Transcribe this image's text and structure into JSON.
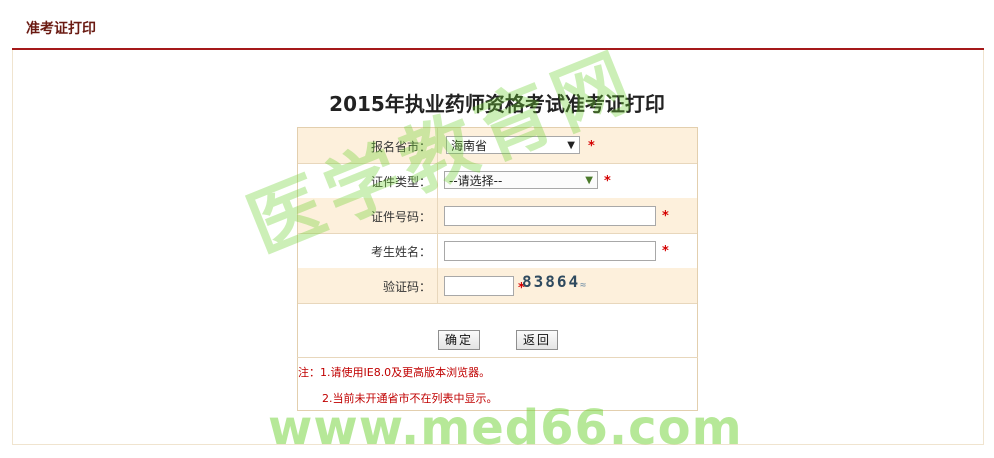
{
  "header": {
    "title": "准考证打印"
  },
  "page_title": "2015年执业药师资格考试准考证打印",
  "form": {
    "province": {
      "label": "报名省市：",
      "value": "海南省"
    },
    "id_type": {
      "label": "证件类型：",
      "value": "--请选择--"
    },
    "id_number": {
      "label": "证件号码：",
      "value": ""
    },
    "name": {
      "label": "考生姓名：",
      "value": ""
    },
    "captcha": {
      "label": "验证码：",
      "value": "",
      "image_text": "83864"
    },
    "required_mark": "*"
  },
  "buttons": {
    "confirm": "确定",
    "back": "返回"
  },
  "notes": {
    "line1": "注：1.请使用IE8.0及更高版本浏览器。",
    "line2": "2.当前未开通省市不在列表中显示。"
  },
  "watermark": {
    "text": "医学教育网",
    "url": "www.med66.com"
  },
  "colors": {
    "accent": "#a5191a",
    "row_shade": "#fdf0dc",
    "note": "#c00000",
    "watermark": "#6ed232"
  }
}
